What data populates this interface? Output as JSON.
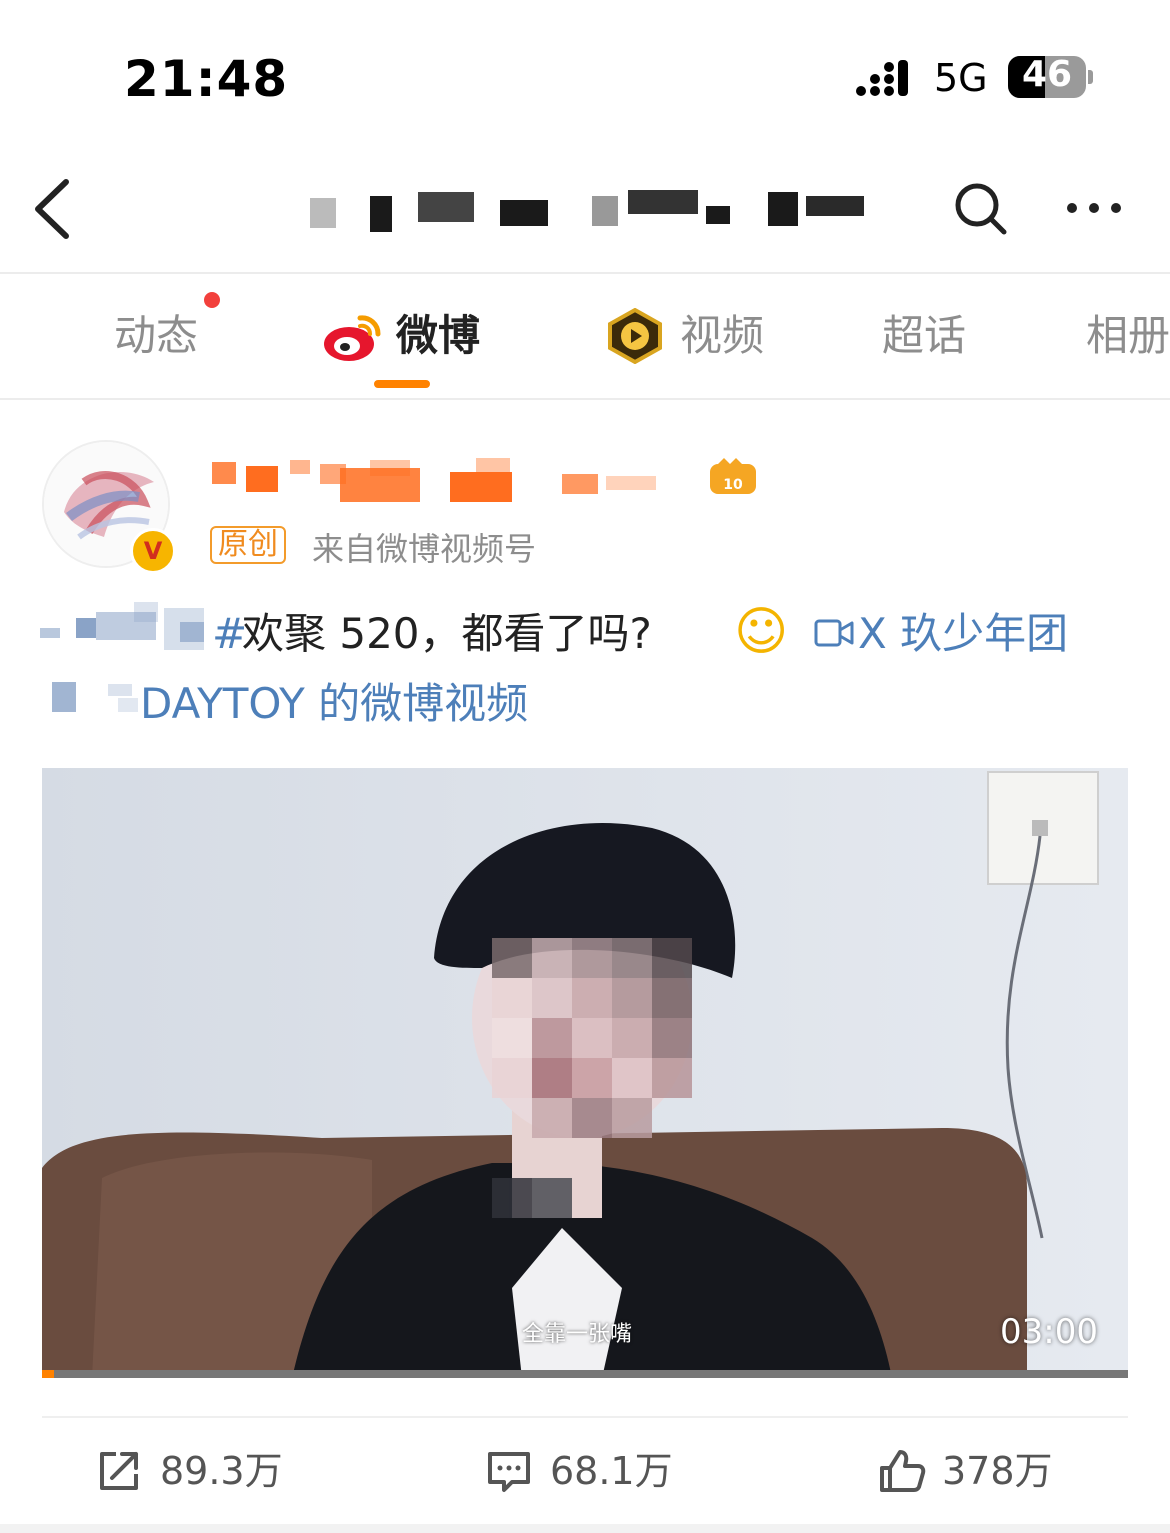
{
  "status_bar": {
    "time": "21:48",
    "network": "5G",
    "battery": "46"
  },
  "nav": {
    "title_redacted": true
  },
  "tabs": [
    {
      "label": "动态",
      "badge": "red-dot"
    },
    {
      "label": "微博",
      "icon": "weibo-logo-icon",
      "active": true
    },
    {
      "label": "视频",
      "icon": "video-badge-icon"
    },
    {
      "label": "超话"
    },
    {
      "label": "相册"
    }
  ],
  "post": {
    "original_tag": "原创",
    "source": "来自微博视频号",
    "text_hashtag_end": "#",
    "text_body": " 欢聚 520，都看了吗?",
    "emoji": "☺",
    "link_part1": "X 玖少年团",
    "link_part2": "DAYTOY 的微博视频",
    "video": {
      "subtitle": "全靠一张嘴",
      "duration": "03:00",
      "progress_fraction": 0.011
    }
  },
  "actions": {
    "repost_count": "89.3万",
    "comment_count": "68.1万",
    "like_count": "378万"
  },
  "colors": {
    "accent": "#ff8200",
    "link": "#4d7fb9",
    "badge_red": "#f2403c"
  }
}
